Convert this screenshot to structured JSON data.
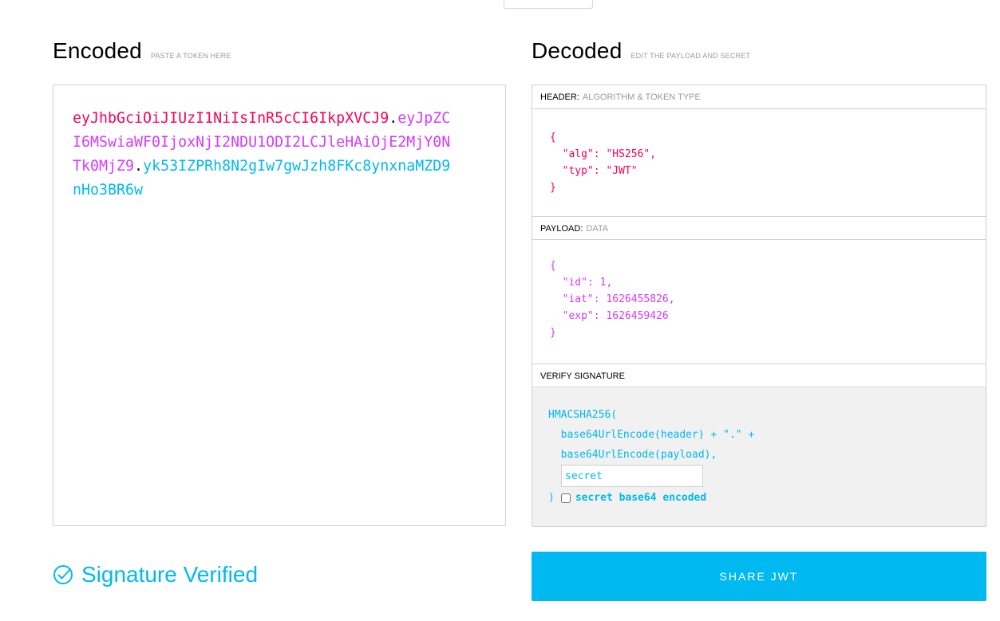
{
  "encoded": {
    "title": "Encoded",
    "subtitle": "PASTE A TOKEN HERE",
    "token": {
      "header": "eyJhbGciOiJIUzI1NiIsInR5cCI6IkpXVCJ9",
      "payload": "eyJpZCI6MSwiaWF0IjoxNjI2NDU1ODI2LCJleHAiOjE2MjY0NTk0MjZ9",
      "signature": "yk53IZPRh8N2gIw7gwJzh8FKc8ynxnaMZD9nHo3BR6w",
      "dot": "."
    }
  },
  "decoded": {
    "title": "Decoded",
    "subtitle": "EDIT THE PAYLOAD AND SECRET",
    "header": {
      "label": "HEADER:",
      "sublabel": "ALGORITHM & TOKEN TYPE",
      "json": "{\n  \"alg\": \"HS256\",\n  \"typ\": \"JWT\"\n}"
    },
    "payload": {
      "label": "PAYLOAD:",
      "sublabel": "DATA",
      "json": "{\n  \"id\": 1,\n  \"iat\": 1626455826,\n  \"exp\": 1626459426\n}"
    },
    "verify": {
      "label": "VERIFY SIGNATURE",
      "fn": "HMACSHA256(",
      "line1": "  base64UrlEncode(header) + \".\" +",
      "line2": "  base64UrlEncode(payload),",
      "secret_value": "secret",
      "close": ")",
      "b64_label": "secret base64 encoded"
    }
  },
  "status": {
    "verified_text": "Signature Verified"
  },
  "share_button": "SHARE JWT",
  "colors": {
    "header": "#fb015b",
    "payload": "#d63aff",
    "signature": "#00b9f1"
  }
}
